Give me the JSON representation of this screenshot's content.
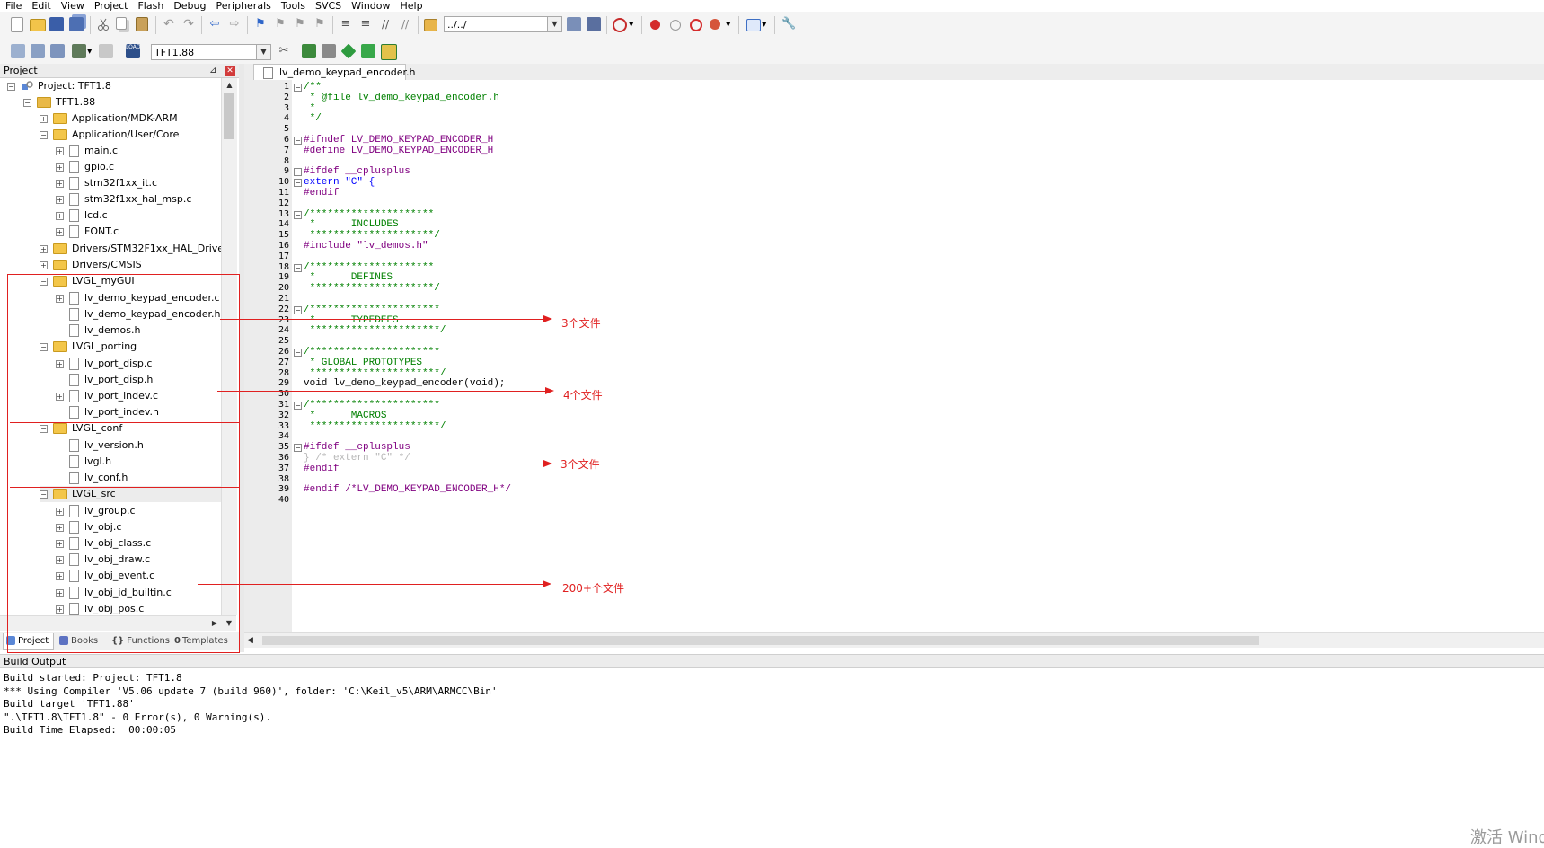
{
  "menu": [
    "File",
    "Edit",
    "View",
    "Project",
    "Flash",
    "Debug",
    "Peripherals",
    "Tools",
    "SVCS",
    "Window",
    "Help"
  ],
  "toolbar": {
    "find_combo_value": "../../",
    "target_combo_value": "TFT1.88",
    "icons": [
      "new-file-icon",
      "open-file-icon",
      "save-icon",
      "save-all-icon",
      "cut-icon",
      "copy-icon",
      "paste-icon",
      "undo-icon",
      "redo-icon",
      "nav-back-icon",
      "nav-forward-icon",
      "bookmark-icon",
      "prev-bookmark-icon",
      "next-bookmark-icon",
      "clear-bookmarks-icon",
      "indent-icon",
      "unindent-icon",
      "comment-icon",
      "uncomment-icon",
      "find-in-files-icon",
      "find-icon",
      "incremental-find-icon",
      "debug-start-icon",
      "breakpoint-icon",
      "disable-breakpoint-icon",
      "kill-breakpoints-icon",
      "window-layout-icon",
      "configure-icon",
      "translate-icon",
      "build-icon",
      "rebuild-icon",
      "batch-build-icon",
      "stop-build-icon",
      "download-icon",
      "target-options-icon",
      "manage-components-icon",
      "select-packs-icon",
      "pack-installer-icon",
      "runtime-env-icon"
    ]
  },
  "project_panel": {
    "title": "Project",
    "tree": [
      {
        "label": "Project: TFT1.8",
        "kind": "project"
      },
      {
        "label": "TFT1.88",
        "kind": "target"
      },
      {
        "label": "Application/MDK-ARM",
        "kind": "group"
      },
      {
        "label": "Application/User/Core",
        "kind": "group"
      },
      {
        "label": "main.c",
        "kind": "file"
      },
      {
        "label": "gpio.c",
        "kind": "file"
      },
      {
        "label": "stm32f1xx_it.c",
        "kind": "file"
      },
      {
        "label": "stm32f1xx_hal_msp.c",
        "kind": "file"
      },
      {
        "label": "lcd.c",
        "kind": "file"
      },
      {
        "label": "FONT.c",
        "kind": "file"
      },
      {
        "label": "Drivers/STM32F1xx_HAL_Driver",
        "kind": "group"
      },
      {
        "label": "Drivers/CMSIS",
        "kind": "group"
      },
      {
        "label": "LVGL_myGUI",
        "kind": "group"
      },
      {
        "label": "lv_demo_keypad_encoder.c",
        "kind": "file"
      },
      {
        "label": "lv_demo_keypad_encoder.h",
        "kind": "file"
      },
      {
        "label": "lv_demos.h",
        "kind": "file"
      },
      {
        "label": "LVGL_porting",
        "kind": "group"
      },
      {
        "label": "lv_port_disp.c",
        "kind": "file"
      },
      {
        "label": "lv_port_disp.h",
        "kind": "file"
      },
      {
        "label": "lv_port_indev.c",
        "kind": "file"
      },
      {
        "label": "lv_port_indev.h",
        "kind": "file"
      },
      {
        "label": "LVGL_conf",
        "kind": "group"
      },
      {
        "label": "lv_version.h",
        "kind": "file"
      },
      {
        "label": "lvgl.h",
        "kind": "file"
      },
      {
        "label": "lv_conf.h",
        "kind": "file"
      },
      {
        "label": "LVGL_src",
        "kind": "group"
      },
      {
        "label": "lv_group.c",
        "kind": "file"
      },
      {
        "label": "lv_obj.c",
        "kind": "file"
      },
      {
        "label": "lv_obj_class.c",
        "kind": "file"
      },
      {
        "label": "lv_obj_draw.c",
        "kind": "file"
      },
      {
        "label": "lv_obj_event.c",
        "kind": "file"
      },
      {
        "label": "lv_obj_id_builtin.c",
        "kind": "file"
      },
      {
        "label": "lv_obj_pos.c",
        "kind": "file"
      }
    ],
    "tabs": [
      "Project",
      "Books",
      "Functions",
      "Templates"
    ]
  },
  "editor": {
    "tab_title": "lv_demo_keypad_encoder.h",
    "lines": [
      "/**",
      " * @file lv_demo_keypad_encoder.h",
      " *",
      " */",
      "",
      "#ifndef LV_DEMO_KEYPAD_ENCODER_H",
      "#define LV_DEMO_KEYPAD_ENCODER_H",
      "",
      "#ifdef __cplusplus",
      "extern \"C\" {",
      "#endif",
      "",
      "/*********************",
      " *      INCLUDES",
      " *********************/",
      "#include \"lv_demos.h\"",
      "",
      "/*********************",
      " *      DEFINES",
      " *********************/",
      "",
      "/**********************",
      " *      TYPEDEFS",
      " **********************/",
      "",
      "/**********************",
      " * GLOBAL PROTOTYPES",
      " **********************/",
      "void lv_demo_keypad_encoder(void);",
      "",
      "/**********************",
      " *      MACROS",
      " **********************/",
      "",
      "#ifdef __cplusplus",
      "} /* extern \"C\" */",
      "#endif",
      "",
      "#endif /*LV_DEMO_KEYPAD_ENCODER_H*/",
      ""
    ]
  },
  "build_output": {
    "title": "Build Output",
    "lines": [
      "Build started: Project: TFT1.8",
      "*** Using Compiler 'V5.06 update 7 (build 960)', folder: 'C:\\Keil_v5\\ARM\\ARMCC\\Bin'",
      "Build target 'TFT1.88'",
      "\".\\TFT1.8\\TFT1.8\" - 0 Error(s), 0 Warning(s).",
      "Build Time Elapsed:  00:00:05"
    ]
  },
  "annotations": [
    "3个文件",
    "4个文件",
    "3个文件",
    "200+个文件"
  ],
  "watermark": "激活 Wind",
  "colors": {
    "annotation": "#e02020",
    "comment": "#008000",
    "preprocessor": "#800080",
    "keyword": "#0000ff",
    "string": "#a31515"
  }
}
